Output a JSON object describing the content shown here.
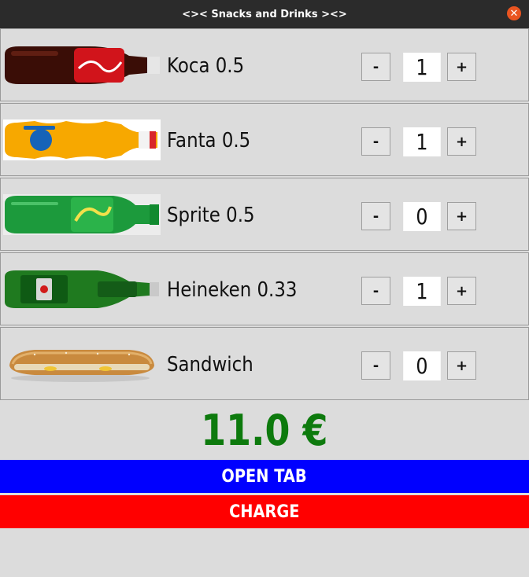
{
  "window": {
    "title": "<>< Snacks and Drinks ><>",
    "close_icon": "close-icon",
    "close_symbol": "✕",
    "close_color": "#e95420"
  },
  "items": [
    {
      "name": "Koca 0.5",
      "image": "cola-bottle-image",
      "minus": "-",
      "quantity": "1",
      "plus": "+"
    },
    {
      "name": "Fanta 0.5",
      "image": "fanta-bottle-image",
      "minus": "-",
      "quantity": "1",
      "plus": "+"
    },
    {
      "name": "Sprite 0.5",
      "image": "sprite-bottle-image",
      "minus": "-",
      "quantity": "0",
      "plus": "+"
    },
    {
      "name": "Heineken 0.33",
      "image": "heineken-bottle-image",
      "minus": "-",
      "quantity": "1",
      "plus": "+"
    },
    {
      "name": "Sandwich",
      "image": "sandwich-image",
      "minus": "-",
      "quantity": "0",
      "plus": "+"
    }
  ],
  "total": "11.0 €",
  "buttons": {
    "open_tab": "OPEN TAB",
    "charge": "CHARGE"
  },
  "colors": {
    "total": "#0d7a0d",
    "open_tab": "#0000ff",
    "charge": "#ff0000"
  }
}
